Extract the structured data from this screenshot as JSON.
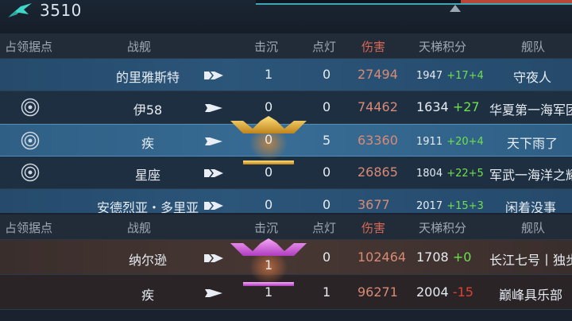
{
  "topbar": {
    "score": "3510",
    "icon": "plane-wings-icon"
  },
  "columns": [
    "占领据点",
    "战舰",
    "击沉",
    "点灯",
    "伤害",
    "天梯积分",
    "舰队"
  ],
  "team_a": [
    {
      "ship": "的里雅斯特",
      "kills": "1",
      "lights": "0",
      "damage": "27494",
      "ladder": "1947",
      "gain": "+17+4",
      "fleet": "守夜人",
      "capture_icon": false
    },
    {
      "ship": "伊58",
      "kills": "0",
      "lights": "0",
      "damage": "74462",
      "ladder": "1634",
      "gain": "+27",
      "fleet": "华夏第一海军团",
      "capture_icon": true
    },
    {
      "ship": "疾",
      "kills": "0",
      "lights": "5",
      "damage": "63360",
      "ladder": "1911",
      "gain": "+20+4",
      "fleet": "天下雨了",
      "capture_icon": true
    },
    {
      "ship": "星座",
      "kills": "0",
      "lights": "0",
      "damage": "26865",
      "ladder": "1804",
      "gain": "+22+5",
      "fleet": "军武一海洋之耀",
      "capture_icon": true
    },
    {
      "ship": "安德烈亚・多里亚",
      "kills": "0",
      "lights": "0",
      "damage": "3677",
      "ladder": "2017",
      "gain": "+15+3",
      "fleet": "闲着没事",
      "capture_icon": false
    }
  ],
  "team_b": [
    {
      "ship": "纳尔逊",
      "kills": "1",
      "lights": "0",
      "damage": "102464",
      "ladder": "1708",
      "gain": "+0",
      "fleet": "长江七号丨独步",
      "capture_icon": false
    },
    {
      "ship": "疾",
      "kills": "1",
      "lights": "1",
      "damage": "96271",
      "ladder": "2004",
      "loss": "-15",
      "fleet": "巅峰具乐部",
      "capture_icon": false
    }
  ],
  "colors": {
    "damage": "#d98a74",
    "gain": "#6fe04e",
    "loss": "#e04030",
    "gold_medal": "#e8b23a",
    "pink_medal": "#d86ae0"
  }
}
